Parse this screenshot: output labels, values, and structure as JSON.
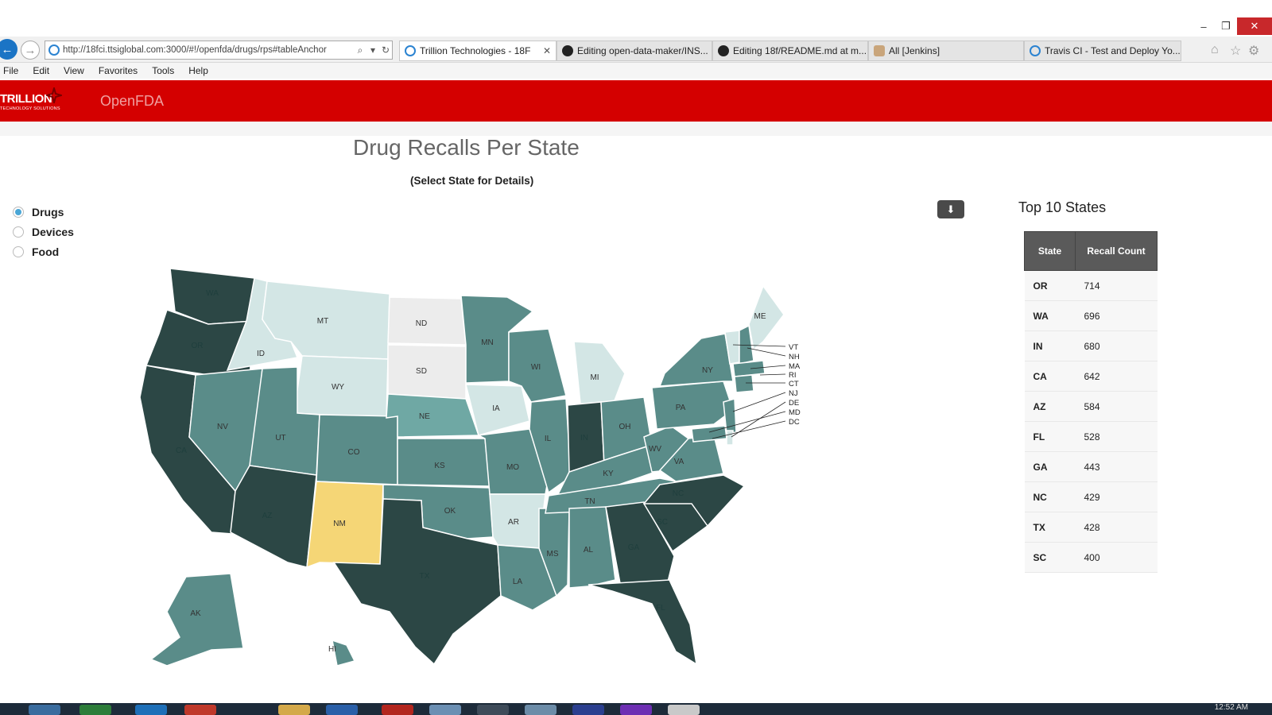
{
  "browser": {
    "url": "http://18fci.ttsiglobal.com:3000/#!/openfda/drugs/rps#tableAnchor",
    "tabs": [
      {
        "label": "Trillion Technologies - 18F",
        "icon": "ie-icon",
        "active": true
      },
      {
        "label": "Editing open-data-maker/INS...",
        "icon": "github-icon"
      },
      {
        "label": "Editing 18f/README.md at m...",
        "icon": "github-icon"
      },
      {
        "label": "All [Jenkins]",
        "icon": "jenkins-icon"
      },
      {
        "label": "Travis CI - Test and Deploy Yo...",
        "icon": "ie-icon"
      }
    ],
    "menu": [
      "File",
      "Edit",
      "View",
      "Favorites",
      "Tools",
      "Help"
    ]
  },
  "app": {
    "logo_text": "TRILLION",
    "logo_sub": "TECHNOLOGY SOLUTIONS",
    "brand": "OpenFDA",
    "accent": "#d40000"
  },
  "main": {
    "title": "Drug Recalls Per State",
    "subtitle": "(Select State for Details)",
    "options": [
      {
        "label": "Drugs",
        "selected": true
      },
      {
        "label": "Devices",
        "selected": false
      },
      {
        "label": "Food",
        "selected": false
      }
    ],
    "download_icon": "download-icon"
  },
  "map": {
    "colors": {
      "darkest": "#2c4745",
      "dark": "#5a8c89",
      "mid": "#6fa8a4",
      "light": "#d3e6e5",
      "none": "#ececec",
      "highlight": "#f5d676"
    },
    "labels": [
      "WA",
      "OR",
      "CA",
      "ID",
      "NV",
      "MT",
      "WY",
      "UT",
      "AZ",
      "CO",
      "NM",
      "ND",
      "SD",
      "NE",
      "KS",
      "OK",
      "TX",
      "MN",
      "IA",
      "MO",
      "AR",
      "LA",
      "WI",
      "IL",
      "MS",
      "MI",
      "IN",
      "KY",
      "TN",
      "AL",
      "GA",
      "FL",
      "OH",
      "WV",
      "VA",
      "NC",
      "SC",
      "PA",
      "NY",
      "ME",
      "AK",
      "HI"
    ],
    "northeast_labels": [
      "VT",
      "NH",
      "MA",
      "RI",
      "CT",
      "NJ",
      "DE",
      "MD",
      "DC"
    ]
  },
  "top10": {
    "title": "Top 10 States",
    "headers": [
      "State",
      "Recall Count"
    ],
    "rows": [
      [
        "OR",
        "714"
      ],
      [
        "WA",
        "696"
      ],
      [
        "IN",
        "680"
      ],
      [
        "CA",
        "642"
      ],
      [
        "AZ",
        "584"
      ],
      [
        "FL",
        "528"
      ],
      [
        "GA",
        "443"
      ],
      [
        "NC",
        "429"
      ],
      [
        "TX",
        "428"
      ],
      [
        "SC",
        "400"
      ]
    ]
  },
  "taskbar": {
    "clock": "12:52 AM"
  }
}
